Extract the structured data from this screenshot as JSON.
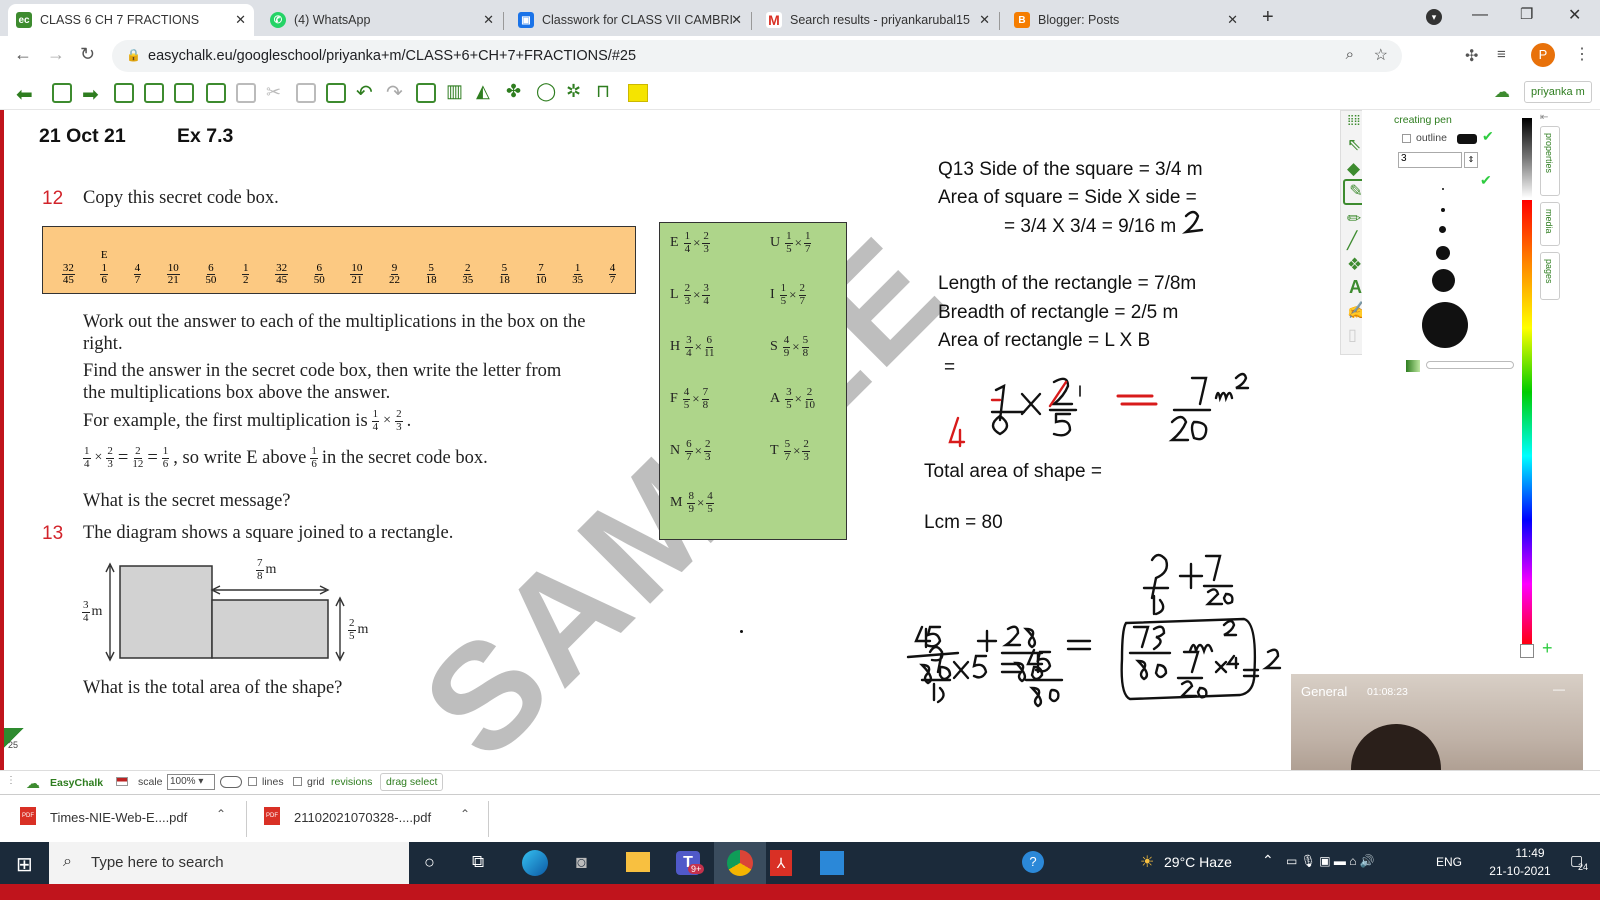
{
  "browser": {
    "tabs": [
      {
        "title": "CLASS 6 CH 7 FRACTIONS",
        "active": true,
        "icon": "easychalk-icon"
      },
      {
        "title": "(4) WhatsApp",
        "active": false,
        "icon": "whatsapp-icon"
      },
      {
        "title": "Classwork for CLASS VII CAMBRI",
        "active": false,
        "icon": "classroom-icon"
      },
      {
        "title": "Search results - priyankarubal15",
        "active": false,
        "icon": "gmail-icon"
      },
      {
        "title": "Blogger: Posts",
        "active": false,
        "icon": "blogger-icon"
      }
    ],
    "url": "easychalk.eu/googleschool/priyanka+m/CLASS+6+CH+7+FRACTIONS/#25",
    "profile_initial": "P"
  },
  "app": {
    "user_label": "priyanka m"
  },
  "board": {
    "date": "21 Oct 21",
    "exercise": "Ex 7.3",
    "watermark": "SAMPLE",
    "q12_num": "12",
    "q12_text": "Copy this secret code box.",
    "code_box": [
      {
        "n": "32",
        "d": "45",
        "letter": ""
      },
      {
        "n": "1",
        "d": "6",
        "letter": "E"
      },
      {
        "n": "4",
        "d": "7",
        "letter": ""
      },
      {
        "n": "10",
        "d": "21",
        "letter": ""
      },
      {
        "n": "6",
        "d": "50",
        "letter": ""
      },
      {
        "n": "1",
        "d": "2",
        "letter": ""
      },
      {
        "n": "32",
        "d": "45",
        "letter": ""
      },
      {
        "n": "6",
        "d": "50",
        "letter": ""
      },
      {
        "n": "10",
        "d": "21",
        "letter": ""
      },
      {
        "n": "9",
        "d": "22",
        "letter": ""
      },
      {
        "n": "5",
        "d": "18",
        "letter": ""
      },
      {
        "n": "2",
        "d": "35",
        "letter": ""
      },
      {
        "n": "5",
        "d": "18",
        "letter": ""
      },
      {
        "n": "7",
        "d": "10",
        "letter": ""
      },
      {
        "n": "1",
        "d": "35",
        "letter": ""
      },
      {
        "n": "4",
        "d": "7",
        "letter": ""
      }
    ],
    "para1": "Work out the answer to each of the multiplications in the box on the right.",
    "para2": "Find the answer in the secret code box, then write the letter from the multiplications box above the answer.",
    "para3_prefix": "For example, the first multiplication is",
    "para4_suffix": ", so write E above",
    "para4_end": "in the secret code box.",
    "para5": "What is the secret message?",
    "q13_num": "13",
    "q13_text": "The diagram shows a square joined to a rectangle.",
    "diagram": {
      "top_label": "m",
      "left_label": "m",
      "right_label": "m"
    },
    "q13_question": "What is the total area of the shape?",
    "mult_box": [
      {
        "letter": "E",
        "a": [
          "1",
          "4"
        ],
        "b": [
          "2",
          "3"
        ]
      },
      {
        "letter": "U",
        "a": [
          "1",
          "5"
        ],
        "b": [
          "1",
          "7"
        ]
      },
      {
        "letter": "L",
        "a": [
          "2",
          "3"
        ],
        "b": [
          "3",
          "4"
        ]
      },
      {
        "letter": "I",
        "a": [
          "1",
          "5"
        ],
        "b": [
          "2",
          "7"
        ]
      },
      {
        "letter": "H",
        "a": [
          "3",
          "4"
        ],
        "b": [
          "6",
          "11"
        ]
      },
      {
        "letter": "S",
        "a": [
          "4",
          "9"
        ],
        "b": [
          "5",
          "8"
        ]
      },
      {
        "letter": "F",
        "a": [
          "4",
          "5"
        ],
        "b": [
          "7",
          "8"
        ]
      },
      {
        "letter": "A",
        "a": [
          "3",
          "5"
        ],
        "b": [
          "2",
          "10"
        ]
      },
      {
        "letter": "N",
        "a": [
          "6",
          "7"
        ],
        "b": [
          "2",
          "3"
        ]
      },
      {
        "letter": "T",
        "a": [
          "5",
          "7"
        ],
        "b": [
          "2",
          "3"
        ]
      },
      {
        "letter": "M",
        "a": [
          "8",
          "9"
        ],
        "b": [
          "4",
          "5"
        ]
      }
    ],
    "typed": {
      "l1": "Q13 Side of the square = 3/4 m",
      "l2": "Area of square = Side X side =",
      "l3": "= 3/4 X 3/4 = 9/16 m",
      "l4": "Length of the rectangle = 7/8m",
      "l5": "Breadth of rectangle = 2/5 m",
      "l6": "Area of rectangle = L X B",
      "l7": "=",
      "l8": "Total area of shape =",
      "l9": "Lcm = 80"
    }
  },
  "right_panel": {
    "title": "creating pen",
    "outline_label": "outline",
    "size_value": "3",
    "side_tabs": [
      "properties",
      "media",
      "pages"
    ]
  },
  "bottom_bar": {
    "brand": "EasyChalk",
    "scale_label": "scale",
    "scale_value": "100%",
    "lines_label": "lines",
    "grid_label": "grid",
    "revisions_label": "revisions",
    "drag_select_label": "drag select",
    "page_number": "25"
  },
  "downloads": [
    {
      "name": "Times-NIE-Web-E....pdf"
    },
    {
      "name": "21102021070328-....pdf"
    }
  ],
  "video": {
    "channel": "General",
    "timer": "01:08:23"
  },
  "taskbar": {
    "search_placeholder": "Type here to search",
    "weather": "29°C  Haze",
    "lang": "ENG",
    "time": "11:49",
    "date": "21-10-2021",
    "teams_badge": "9+",
    "notif_count": "24"
  }
}
